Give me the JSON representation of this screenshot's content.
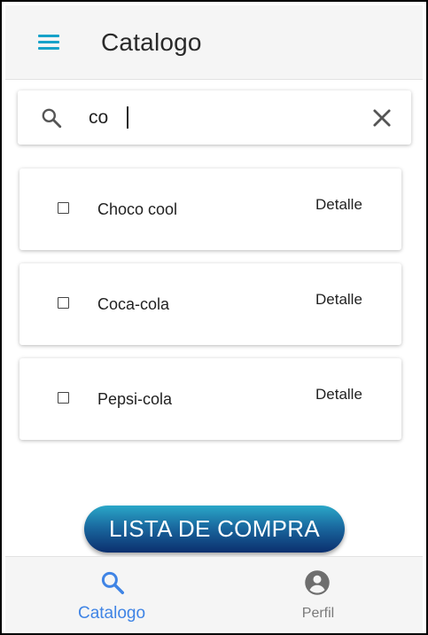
{
  "header": {
    "title": "Catalogo",
    "menu_icon": "menu-icon"
  },
  "search": {
    "value": "co",
    "placeholder": "",
    "search_icon": "search-icon",
    "clear_icon": "close-icon"
  },
  "items": [
    {
      "name": "Choco cool",
      "checked": false,
      "action": "Detalle"
    },
    {
      "name": "Coca-cola",
      "checked": false,
      "action": "Detalle"
    },
    {
      "name": "Pepsi-cola",
      "checked": false,
      "action": "Detalle"
    }
  ],
  "cta": {
    "label": "LISTA DE COMPRA"
  },
  "bottom_nav": {
    "items": [
      {
        "label": "Catalogo",
        "icon": "search-icon",
        "active": true
      },
      {
        "label": "Perfil",
        "icon": "account-circle-icon",
        "active": false
      }
    ]
  },
  "colors": {
    "accent": "#17a2c9",
    "active_nav": "#3f84e5",
    "inactive_nav": "#7a7a7a",
    "cta_top": "#2aa7c8",
    "cta_bottom": "#0b2f6e"
  }
}
